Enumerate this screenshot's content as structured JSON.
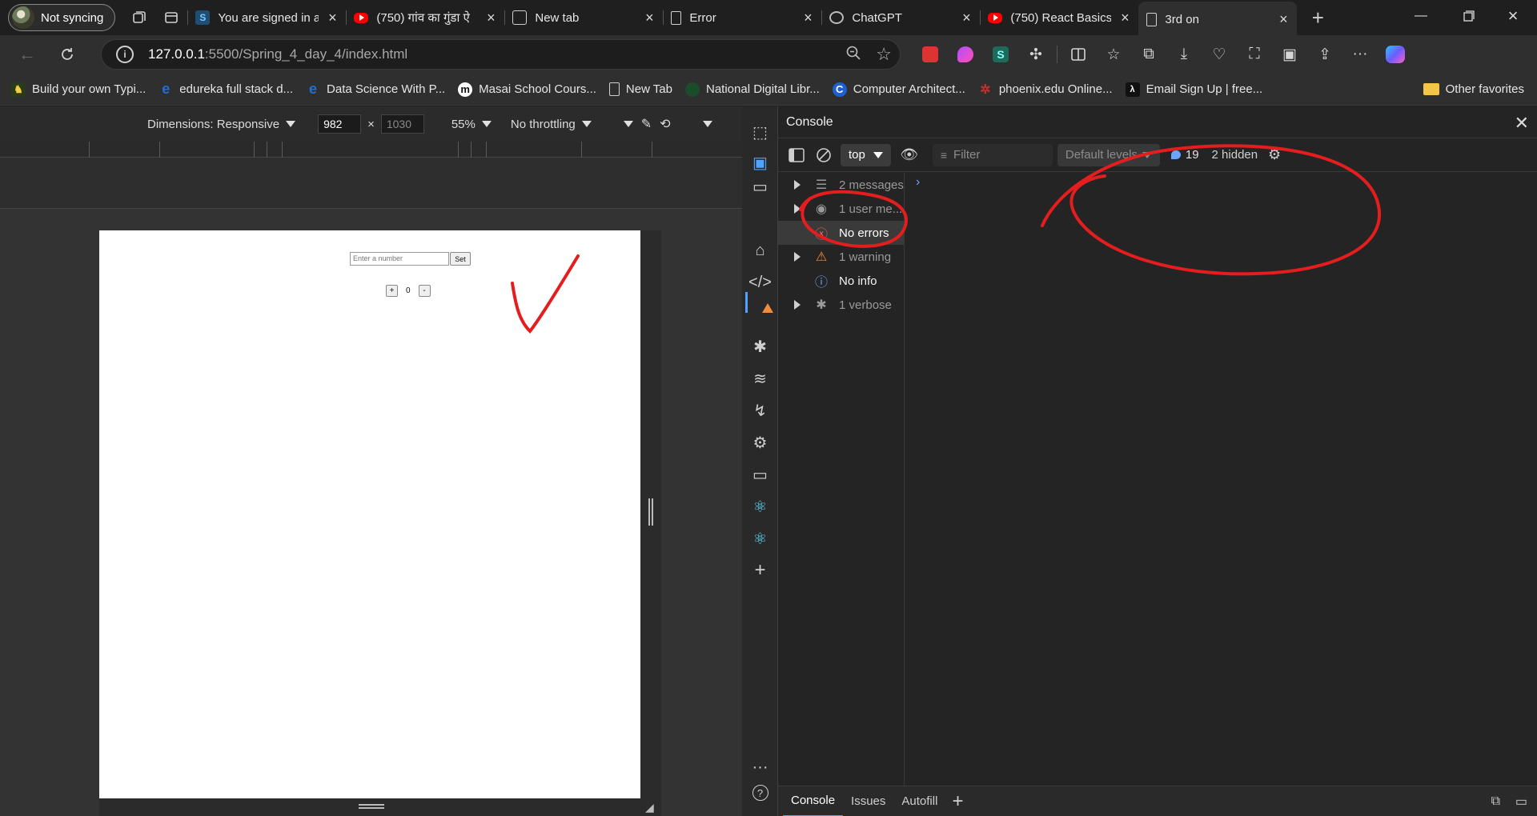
{
  "browser": {
    "profile_label": "Not syncing",
    "tabs": [
      {
        "title": "You are signed in a",
        "icon": "s-favicon"
      },
      {
        "title": "(750) गांव का गुंडा ऐ",
        "icon": "youtube-favicon"
      },
      {
        "title": "New tab",
        "icon": "newtab-favicon"
      },
      {
        "title": "Error",
        "icon": "page-favicon"
      },
      {
        "title": "ChatGPT",
        "icon": "chatgpt-favicon"
      },
      {
        "title": "(750) React Basics",
        "icon": "youtube-favicon"
      },
      {
        "title": "3rd on",
        "icon": "page-favicon"
      }
    ],
    "url_host": "127.0.0.1",
    "url_path": ":5500/Spring_4_day_4/index.html",
    "favorites": [
      {
        "label": "Build your own Typi...",
        "icon": "typing-favicon"
      },
      {
        "label": "edureka full stack d...",
        "icon": "edureka-favicon"
      },
      {
        "label": "Data Science With P...",
        "icon": "edureka-favicon"
      },
      {
        "label": "Masai School Cours...",
        "icon": "masai-favicon"
      },
      {
        "label": "New Tab",
        "icon": "page-favicon"
      },
      {
        "label": "National Digital Libr...",
        "icon": "ndl-favicon"
      },
      {
        "label": "Computer Architect...",
        "icon": "c-favicon"
      },
      {
        "label": "phoenix.edu Online...",
        "icon": "phoenix-favicon"
      },
      {
        "label": "Email Sign Up | free...",
        "icon": "lambda-favicon"
      }
    ],
    "other_favorites": "Other favorites"
  },
  "device_toolbar": {
    "dimensions_label": "Dimensions: Responsive",
    "width": "982",
    "height": "1030",
    "zoom": "55%",
    "throttling": "No throttling"
  },
  "page": {
    "input_placeholder": "Enter a number",
    "set_label": "Set",
    "plus_label": "+",
    "counter_value": "0",
    "minus_label": "-"
  },
  "devtools": {
    "panel_title": "Console",
    "context": "top",
    "filter_placeholder": "Filter",
    "levels": "Default levels",
    "message_count": "19",
    "hidden": "2 hidden",
    "sidebar": [
      {
        "label": "2 messages",
        "icon": "list-icon"
      },
      {
        "label": "1 user me...",
        "icon": "user-icon"
      },
      {
        "label": "No errors",
        "icon": "error-icon"
      },
      {
        "label": "1 warning",
        "icon": "warning-icon"
      },
      {
        "label": "No info",
        "icon": "info-icon"
      },
      {
        "label": "1 verbose",
        "icon": "bug-icon"
      }
    ],
    "drawer_tabs": [
      "Console",
      "Issues",
      "Autofill"
    ]
  },
  "colors": {
    "accent_blue": "#4da3ff",
    "annotation_red": "#e41e1e",
    "warning_orange": "#f28b3c",
    "react_cyan": "#61dafb"
  }
}
